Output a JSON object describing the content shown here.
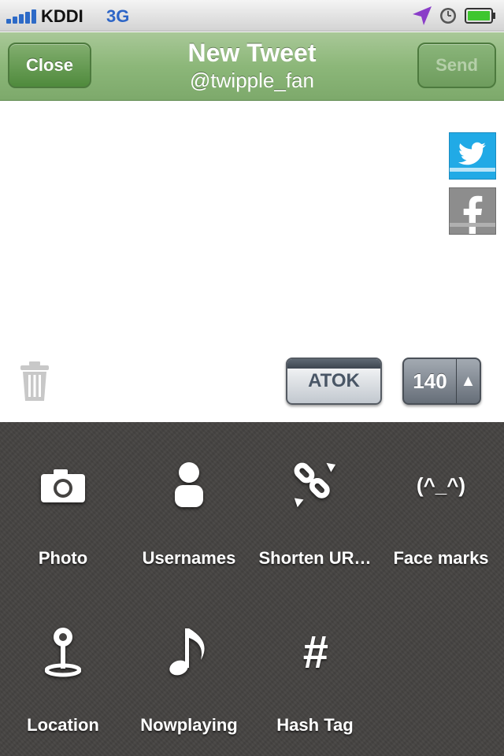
{
  "status_bar": {
    "carrier": "KDDI",
    "network": "3G",
    "icons": [
      "signal-icon",
      "location-arrow-icon",
      "clock-icon",
      "battery-icon"
    ]
  },
  "nav": {
    "close_label": "Close",
    "title": "New Tweet",
    "subtitle": "@twipple_fan",
    "send_label": "Send"
  },
  "compose": {
    "text": "",
    "atok_label": "ATOK",
    "char_count": "140",
    "count_arrow": "▲",
    "share_icons": [
      "twitter-icon",
      "facebook-icon"
    ],
    "trash_icon": "trash-icon"
  },
  "tools": [
    {
      "label": "Photo",
      "icon": "camera-icon"
    },
    {
      "label": "Usernames",
      "icon": "person-icon"
    },
    {
      "label": "Shorten UR…",
      "icon": "broken-link-icon"
    },
    {
      "label": "Face marks",
      "icon_text": "(^_^)"
    },
    {
      "label": "Location",
      "icon": "map-pin-icon"
    },
    {
      "label": "Nowplaying",
      "icon": "music-note-icon"
    },
    {
      "label": "Hash Tag",
      "icon_text": "#"
    }
  ],
  "colors": {
    "nav_green": "#8cb779",
    "twitter_blue": "#21aae6",
    "palette_bg": "#454341"
  }
}
